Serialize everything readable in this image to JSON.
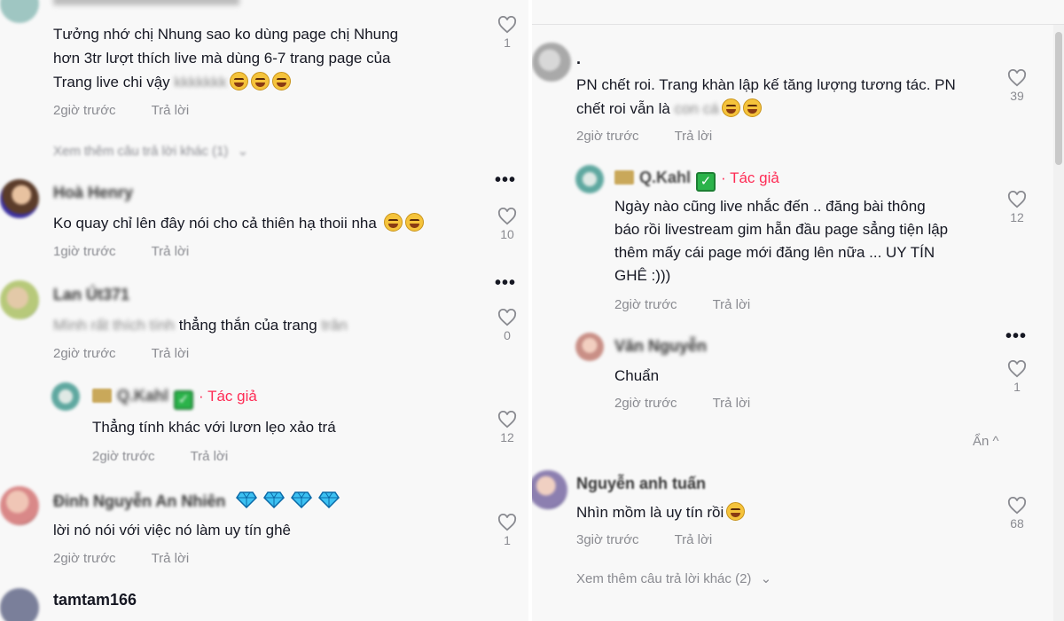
{
  "left": {
    "comments": [
      {
        "text_line1": "Tưởng nhớ chị Nhung sao ko dùng page chị Nhung",
        "text_line2": "hơn 3tr lượt thích live mà dùng 6-7 trang page của",
        "text_line3": "Trang live chi vậy",
        "text_blurred": "kkkkkkk",
        "time": "2giờ trước",
        "reply": "Trả lời",
        "likes": "1",
        "view_more": "Xem thêm câu trả lời khác (1)"
      },
      {
        "name": "Hoà Henry",
        "text": "Ko quay chỉ lên đây nói cho cả thiên hạ thoii nha",
        "time": "1giờ trước",
        "reply": "Trả lời",
        "likes": "10"
      },
      {
        "name": "Lan Út371",
        "text_blurred_start": "Mình rất thích tính",
        "text": "thẳng thắn của trang",
        "text_blurred_end": "trân",
        "time": "2giờ trước",
        "reply": "Trả lời",
        "likes": "0"
      },
      {
        "name": "Q.Kahl",
        "author_label": "· Tác giả",
        "text": "Thẳng tính khác với lươn lẹo xảo trá",
        "time": "2giờ trước",
        "reply": "Trả lời",
        "likes": "12"
      },
      {
        "name": "Đinh Nguyễn An Nhiên",
        "text": "lời nó nói với việc nó làm uy tín ghê",
        "time": "2giờ trước",
        "reply": "Trả lời",
        "likes": "1"
      },
      {
        "name": "tamtam166"
      }
    ]
  },
  "right": {
    "comments": [
      {
        "name": ".",
        "text_line1": "PN chết roi. Trang khàn lập kế tăng lượng tương tác. PN",
        "text_line2": "chết roi vẫn là",
        "text_blurred": "con cá",
        "time": "2giờ trước",
        "reply": "Trả lời",
        "likes": "39"
      },
      {
        "name": "Q.Kahl",
        "author_label": "· Tác giả",
        "text_line1": "Ngày nào cũng live nhắc đến .. đăng bài thông",
        "text_line2": "báo rồi livestream gim hẵn đầu page sẳng tiện lập",
        "text_line3": "thêm mấy cái page mới đăng lên nữa ... UY TÍN",
        "text_line4": "GHÊ :)))",
        "time": "2giờ trước",
        "reply": "Trả lời",
        "likes": "12"
      },
      {
        "name": "Văn Nguyễn",
        "text": "Chuẩn",
        "time": "2giờ trước",
        "reply": "Trả lời",
        "likes": "1"
      },
      {
        "hide_label": "Ẩn ^"
      },
      {
        "name": "Nguyễn anh tuấn",
        "text": "Nhìn mồm là uy tín rồi",
        "time": "3giờ trước",
        "reply": "Trả lời",
        "likes": "68",
        "view_more": "Xem thêm câu trả lời khác (2)"
      }
    ]
  },
  "icons": {
    "like": "heart-outline-icon",
    "more": "more-dots-icon",
    "emoji": "grinning-emoji-icon",
    "gem": "diamond-icon",
    "chevron": "chevron-down-icon"
  },
  "colors": {
    "author": "#fe2c55",
    "meta": "#8a8b91",
    "text": "#161823"
  }
}
